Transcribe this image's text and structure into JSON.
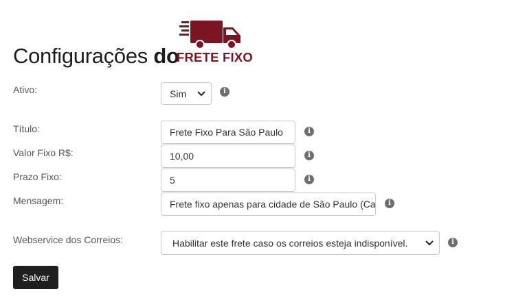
{
  "header": {
    "title_prefix": "Configurações ",
    "title_bold": "do",
    "logo_text": "FRETE FIXO",
    "logo_icon": "delivery-truck-icon",
    "brand_color": "#7a1622"
  },
  "form": {
    "ativo": {
      "label": "Ativo:",
      "value": "Sim"
    },
    "titulo": {
      "label": "Título:",
      "value": "Frete Fixo Para São Paulo"
    },
    "valor": {
      "label": "Valor Fixo R$:",
      "value": "10,00"
    },
    "prazo": {
      "label": "Prazo Fixo:",
      "value": "5"
    },
    "mensagem": {
      "label": "Mensagem:",
      "value": "Frete fixo apenas para cidade de São Paulo  (Capital)"
    },
    "webservice": {
      "label": "Webservice dos Correios:",
      "value": "Habilitar este frete caso os correios esteja indisponível."
    },
    "info_icon": "info-circle-icon",
    "info_glyph": "i"
  },
  "actions": {
    "save_label": "Salvar"
  }
}
